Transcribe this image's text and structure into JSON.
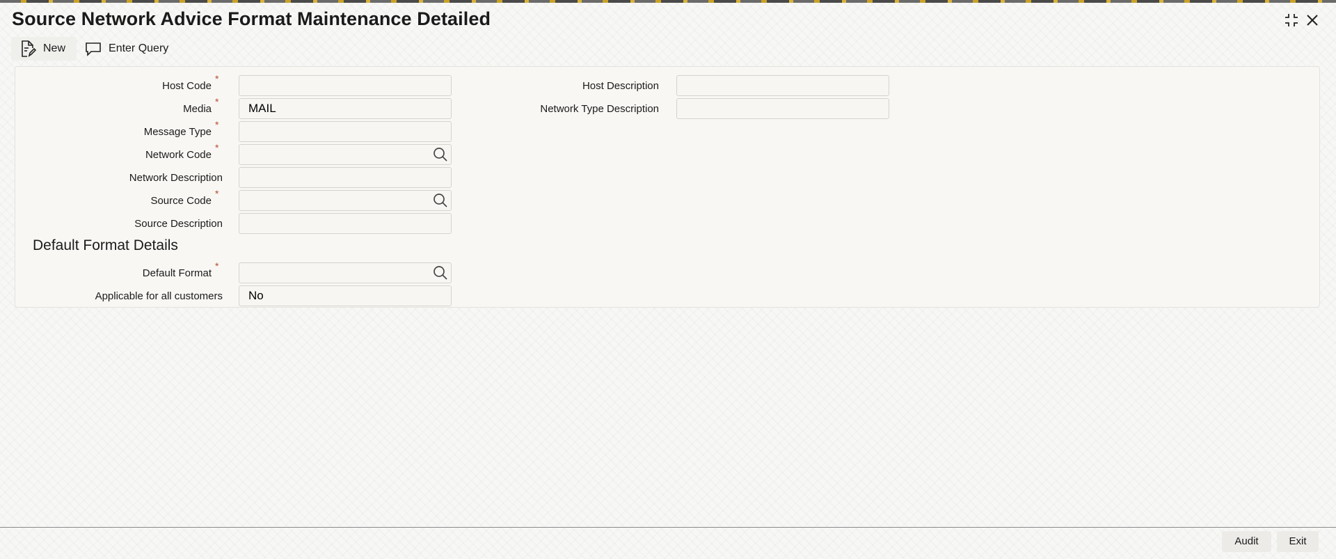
{
  "window": {
    "title": "Source Network Advice Format Maintenance Detailed"
  },
  "toolbar": {
    "new_label": "New",
    "enter_query_label": "Enter Query"
  },
  "form": {
    "required_marker": "*",
    "host_code": {
      "label": "Host Code",
      "value": ""
    },
    "media": {
      "label": "Media",
      "value": "MAIL"
    },
    "message_type": {
      "label": "Message Type",
      "value": ""
    },
    "network_code": {
      "label": "Network Code",
      "value": ""
    },
    "network_description": {
      "label": "Network Description",
      "value": ""
    },
    "source_code": {
      "label": "Source Code",
      "value": ""
    },
    "source_description": {
      "label": "Source Description",
      "value": ""
    },
    "host_description": {
      "label": "Host Description",
      "value": ""
    },
    "network_type_description": {
      "label": "Network Type Description",
      "value": ""
    }
  },
  "default_format_section": {
    "title": "Default Format Details",
    "default_format": {
      "label": "Default Format",
      "value": ""
    },
    "applicable_all_customers": {
      "label": "Applicable for all customers",
      "value": "No"
    }
  },
  "footer": {
    "audit_label": "Audit",
    "exit_label": "Exit"
  },
  "icons": {
    "new": "document-edit-icon",
    "enter_query": "speech-bubble-icon",
    "lookup": "search-icon",
    "maximize": "maximize-icon",
    "close": "close-icon"
  },
  "colors": {
    "required_asterisk": "#b34f2c",
    "panel_background": "#f8f7f4"
  }
}
